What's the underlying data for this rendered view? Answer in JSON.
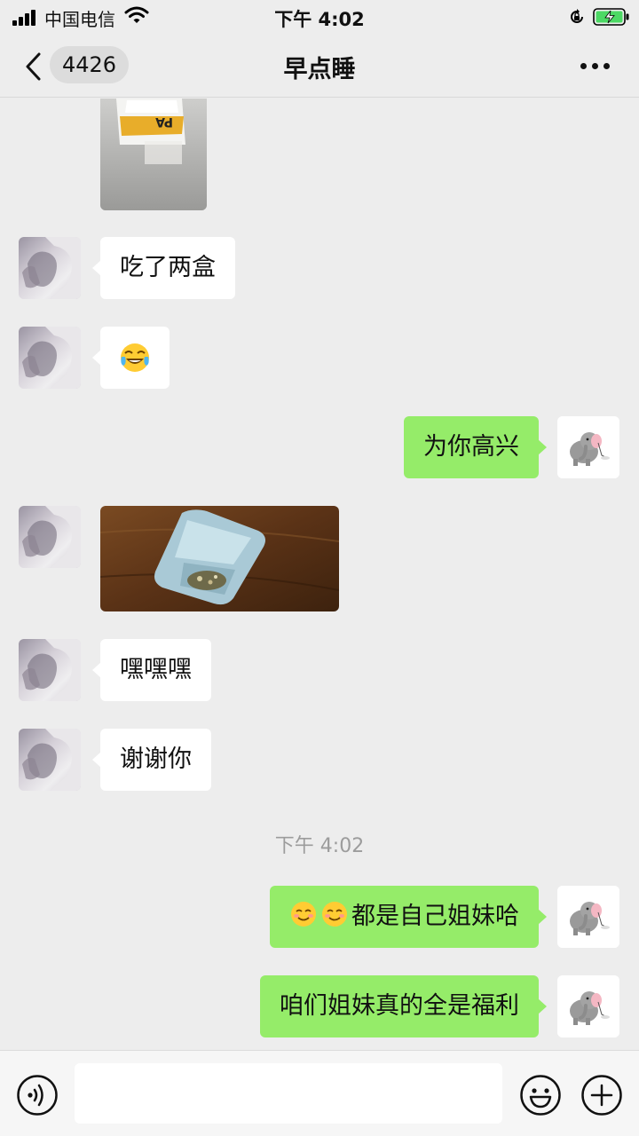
{
  "status_bar": {
    "carrier": "中国电信",
    "time": "下午 4:02"
  },
  "nav": {
    "unread_count": "4426",
    "title": "早点睡",
    "icons": [
      "chevron-left-icon",
      "more-dots-icon"
    ]
  },
  "messages": [
    {
      "id": "m1",
      "from": "contact",
      "type": "image",
      "image_name": "yogurt-package-photo"
    },
    {
      "id": "m2",
      "from": "contact",
      "type": "text",
      "text": "吃了两盒"
    },
    {
      "id": "m3",
      "from": "contact",
      "type": "emoji",
      "emoji_name": "tears-of-joy-emoji"
    },
    {
      "id": "m4",
      "from": "me",
      "type": "text",
      "text": "为你高兴"
    },
    {
      "id": "m5",
      "from": "contact",
      "type": "image",
      "image_name": "yogurt-cup-on-table-photo"
    },
    {
      "id": "m6",
      "from": "contact",
      "type": "text",
      "text": "嘿嘿嘿"
    },
    {
      "id": "m7",
      "from": "contact",
      "type": "text",
      "text": "谢谢你"
    },
    {
      "id": "m8",
      "from": "me",
      "type": "text",
      "emoji_prefix": [
        "smiling-face-emoji",
        "smiling-face-emoji"
      ],
      "text": "都是自己姐妹哈"
    },
    {
      "id": "m9",
      "from": "me",
      "type": "text",
      "text": "咱们姐妹真的全是福利"
    }
  ],
  "time_divider": "下午 4:02",
  "input_bar": {
    "placeholder": "",
    "icons": [
      "voice-icon",
      "emoji-icon",
      "plus-icon"
    ]
  },
  "colors": {
    "background": "#ededed",
    "outgoing_bubble": "#95ec69",
    "incoming_bubble": "#ffffff",
    "battery_charging": "#4cd964"
  }
}
